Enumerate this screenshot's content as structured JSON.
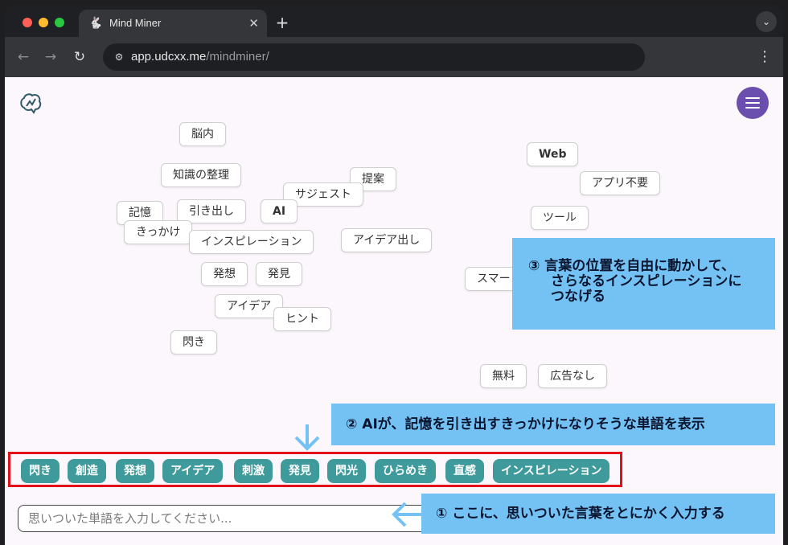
{
  "browser": {
    "tab_title": "Mind Miner",
    "tab_close": "✕",
    "new_tab": "+",
    "url_host": "app.udcxx.me",
    "url_path": "/mindminer/"
  },
  "words": [
    {
      "text": "脳内"
    },
    {
      "text": "知識の整理"
    },
    {
      "text": "提案"
    },
    {
      "text": "サジェスト"
    },
    {
      "text": "記憶"
    },
    {
      "text": "引き出し"
    },
    {
      "text": "AI"
    },
    {
      "text": "きっかけ"
    },
    {
      "text": "インスピレーション"
    },
    {
      "text": "アイデア出し"
    },
    {
      "text": "発想"
    },
    {
      "text": "発見"
    },
    {
      "text": "アイデア"
    },
    {
      "text": "ヒント"
    },
    {
      "text": "閃き"
    },
    {
      "text": "Web"
    },
    {
      "text": "アプリ不要"
    },
    {
      "text": "ツール"
    },
    {
      "text": "スマー"
    },
    {
      "text": "無料"
    },
    {
      "text": "広告なし"
    }
  ],
  "callouts": {
    "c3_line1": "③ 言葉の位置を自由に動かして、",
    "c3_line2": "さらなるインスピレーションに",
    "c3_line3": "つなげる",
    "c2": "② AIが、記憶を引き出すきっかけになりそうな単語を表示",
    "c1": "① ここに、思いついた言葉をとにかく入力する"
  },
  "suggestions": [
    "閃き",
    "創造",
    "発想",
    "アイデア",
    "刺激",
    "発見",
    "閃光",
    "ひらめき",
    "直感",
    "インスピレーション"
  ],
  "input": {
    "placeholder": "思いついた単語を入力してください...",
    "value": ""
  },
  "colors": {
    "menu_button": "#6a4fae",
    "chip": "#3f9a9c",
    "callout": "#74c2f4",
    "highlight_border": "#e20e18"
  },
  "icons": [
    "brain-logo-icon",
    "hamburger-menu-icon",
    "arrow-down-icon",
    "arrow-left-icon"
  ]
}
